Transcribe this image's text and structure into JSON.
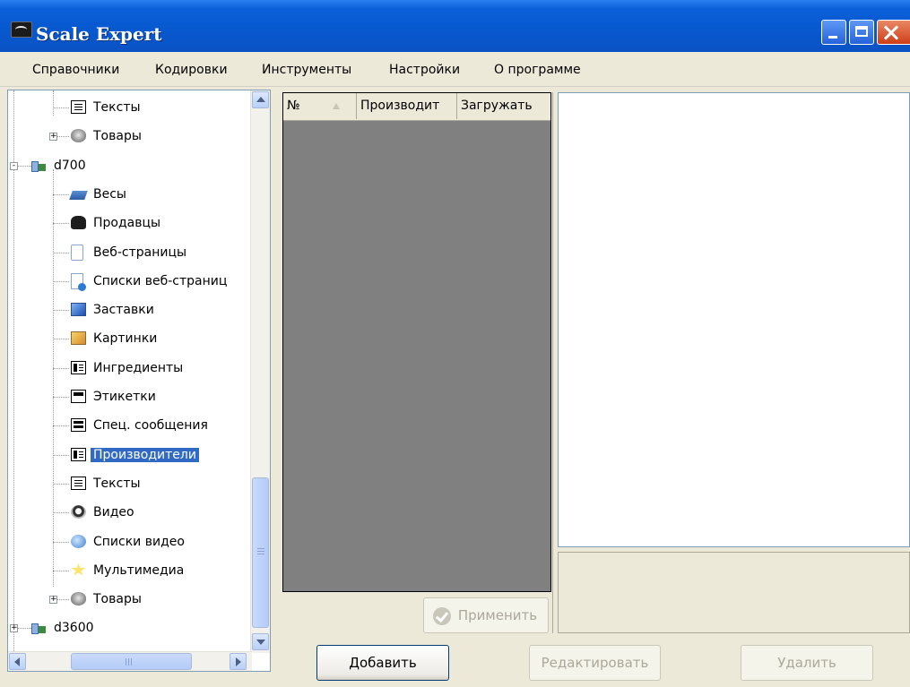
{
  "window": {
    "title": "Scale Expert"
  },
  "menu": [
    "Справочники",
    "Кодировки",
    "Инструменты",
    "Настройки",
    "О программе"
  ],
  "tree": [
    {
      "label": "Тексты",
      "icon": "text-icon",
      "level": 2
    },
    {
      "label": "Товары",
      "icon": "disk-icon",
      "level": 2,
      "expander": "+"
    },
    {
      "label": "d700",
      "icon": "network-icon",
      "level": 1,
      "expander": "-"
    },
    {
      "label": "Весы",
      "icon": "scale-icon",
      "level": 2
    },
    {
      "label": "Продавцы",
      "icon": "user-icon",
      "level": 2
    },
    {
      "label": "Веб-страницы",
      "icon": "page-icon",
      "level": 2
    },
    {
      "label": "Списки веб-страниц",
      "icon": "page-list-icon",
      "level": 2
    },
    {
      "label": "Заставки",
      "icon": "screensaver-icon",
      "level": 2
    },
    {
      "label": "Картинки",
      "icon": "picture-icon",
      "level": 2
    },
    {
      "label": "Ингредиенты",
      "icon": "ingredients-icon",
      "level": 2
    },
    {
      "label": "Этикетки",
      "icon": "label-icon",
      "level": 2
    },
    {
      "label": "Спец. сообщения",
      "icon": "message-icon",
      "level": 2
    },
    {
      "label": "Производители",
      "icon": "manufacturer-icon",
      "level": 2,
      "selected": true
    },
    {
      "label": "Тексты",
      "icon": "text-icon",
      "level": 2
    },
    {
      "label": "Видео",
      "icon": "video-icon",
      "level": 2
    },
    {
      "label": "Списки видео",
      "icon": "video-list-icon",
      "level": 2
    },
    {
      "label": "Мультимедиа",
      "icon": "star-icon",
      "level": 2
    },
    {
      "label": "Товары",
      "icon": "disk-icon",
      "level": 2,
      "expander": "+"
    },
    {
      "label": "d3600",
      "icon": "network-icon",
      "level": 1,
      "expander": "+"
    }
  ],
  "grid": {
    "columns": [
      "№",
      "Производит",
      "Загружать"
    ]
  },
  "buttons": {
    "apply": "Применить",
    "add": "Добавить",
    "edit": "Редактировать",
    "delete": "Удалить"
  },
  "colors": {
    "titlebar": "#0a5fd8",
    "selection": "#316ac5",
    "grid_background": "#808080"
  }
}
